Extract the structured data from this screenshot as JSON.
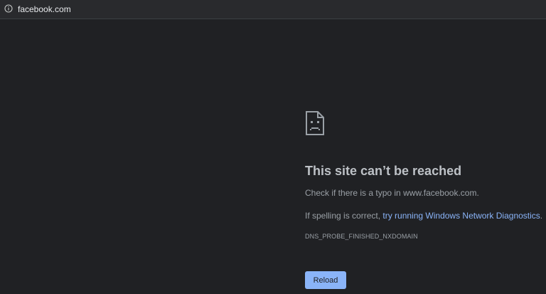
{
  "addressbar": {
    "url": "facebook.com",
    "icon": "info-icon"
  },
  "error": {
    "icon": "sad-page-icon",
    "title": "This site can’t be reached",
    "line1": "Check if there is a typo in www.facebook.com.",
    "line2_prefix": "If spelling is correct, ",
    "line2_link": "try running Windows Network Diagnostics",
    "line2_suffix": ".",
    "code": "DNS_PROBE_FINISHED_NXDOMAIN",
    "reload_label": "Reload"
  },
  "colors": {
    "background": "#202124",
    "title": "#bdc1c6",
    "text": "#9aa0a6",
    "link": "#8ab4f8",
    "button": "#8ab4f8"
  }
}
